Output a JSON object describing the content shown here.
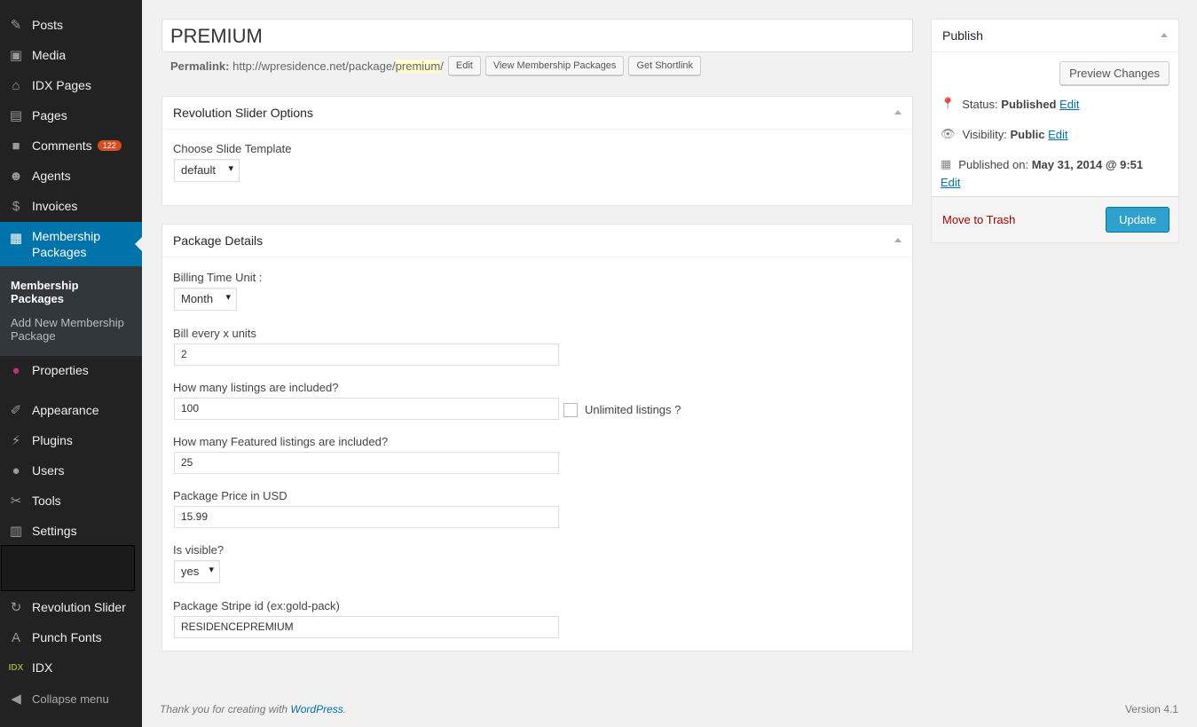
{
  "sidebar": {
    "items": [
      {
        "label": "Posts",
        "icon": "pin-icon"
      },
      {
        "label": "Media",
        "icon": "media-icon"
      },
      {
        "label": "IDX Pages",
        "icon": "home-icon"
      },
      {
        "label": "Pages",
        "icon": "pages-icon"
      },
      {
        "label": "Comments",
        "icon": "comment-icon",
        "badge": "122"
      },
      {
        "label": "Agents",
        "icon": "agents-icon"
      },
      {
        "label": "Invoices",
        "icon": "invoice-icon"
      },
      {
        "label": "Membership Packages",
        "icon": "calendar-icon"
      },
      {
        "label": "Properties",
        "icon": "location-icon"
      },
      {
        "label": "Appearance",
        "icon": "brush-icon"
      },
      {
        "label": "Plugins",
        "icon": "plugin-icon"
      },
      {
        "label": "Users",
        "icon": "user-icon"
      },
      {
        "label": "Tools",
        "icon": "wrench-icon"
      },
      {
        "label": "Settings",
        "icon": "settings-icon"
      },
      {
        "label": "Revolution Slider",
        "icon": "refresh-icon"
      },
      {
        "label": "Punch Fonts",
        "icon": "font-icon"
      },
      {
        "label": "IDX",
        "icon": "idx-icon"
      }
    ],
    "submenu": [
      "Membership Packages",
      "Add New Membership Package"
    ],
    "collapse": "Collapse menu"
  },
  "post": {
    "title": "PREMIUM",
    "permalink_label": "Permalink:",
    "permalink_base": "http://wpresidence.net/package/",
    "permalink_slug": "premium",
    "permalink_end": "/",
    "edit": "Edit",
    "view": "View Membership Packages",
    "shortlink": "Get Shortlink"
  },
  "slider_box": {
    "title": "Revolution Slider Options",
    "label": "Choose Slide Template",
    "value": "default"
  },
  "package": {
    "title": "Package Details",
    "billing_label": "Billing Time Unit :",
    "billing_value": "Month",
    "bill_every_label": "Bill every x units",
    "bill_every_value": "2",
    "listings_label": "How many listings are included?",
    "listings_value": "100",
    "unlimited_label": "Unlimited listings ?",
    "unlimited_checked": false,
    "featured_label": "How many Featured listings are included?",
    "featured_value": "25",
    "price_label": "Package Price in USD",
    "price_value": "15.99",
    "visible_label": "Is visible?",
    "visible_value": "yes",
    "stripe_label": "Package Stripe id (ex:gold-pack)",
    "stripe_value": "RESIDENCEPREMIUM"
  },
  "publish": {
    "title": "Publish",
    "preview": "Preview Changes",
    "status_label": "Status:",
    "status": "Published",
    "visibility_label": "Visibility:",
    "visibility": "Public",
    "published_label": "Published on:",
    "published": "May 31, 2014 @ 9:51",
    "edit": "Edit",
    "trash": "Move to Trash",
    "update": "Update",
    "accent": "#2ea2cc"
  },
  "footer": {
    "thanks": "Thank you for creating with ",
    "wp": "WordPress",
    "dot": ".",
    "version": "Version 4.1"
  }
}
